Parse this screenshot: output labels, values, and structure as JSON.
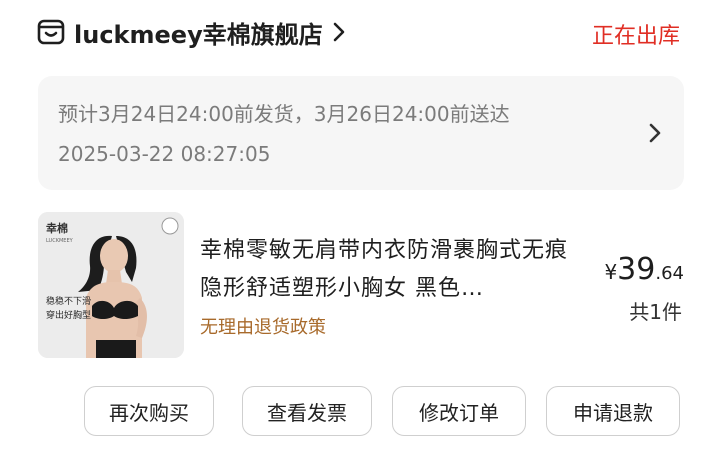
{
  "store": {
    "name": "luckmeey幸棉旗舰店",
    "status": "正在出库"
  },
  "shipping": {
    "estimate": "预计3月24日24:00前发货，3月26日24:00前送达",
    "timestamp": "2025-03-22 08:27:05"
  },
  "product": {
    "title": "幸棉零敏无肩带内衣防滑裹胸式无痕隐形舒适塑形小胸女 黑色…",
    "policy": "无理由退货政策",
    "price_currency": "¥",
    "price_int": "39",
    "price_dec": ".64",
    "quantity": "共1件",
    "thumb_brand": "幸棉",
    "thumb_brand_sub": "LUCKMEEY",
    "thumb_slogan1": "稳稳不下滑",
    "thumb_slogan2": "穿出好胸型"
  },
  "buttons": {
    "rebuy": "再次购买",
    "invoice": "查看发票",
    "modify": "修改订单",
    "refund": "申请退款"
  },
  "colors": {
    "status": "#e02e24",
    "policy": "#a86a2b",
    "box_bg": "#f6f6f6"
  }
}
